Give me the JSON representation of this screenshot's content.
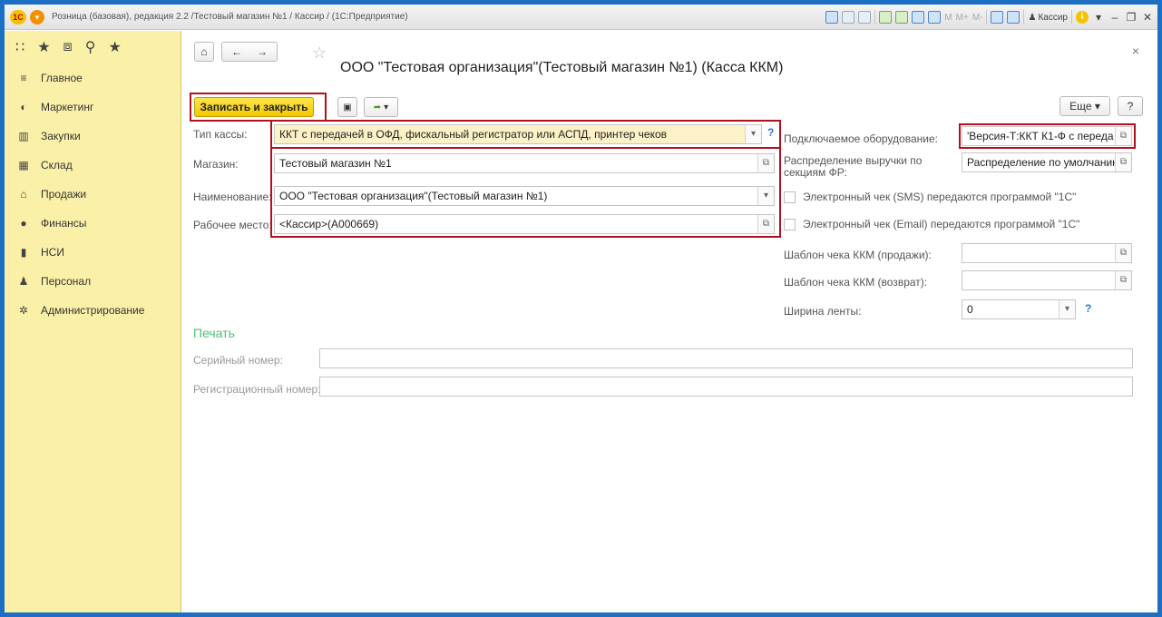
{
  "window": {
    "title": "Розница (базовая), редакция 2.2 /Тестовый магазин №1 / Кассир / (1С:Предприятие)",
    "logo_text": "1С",
    "user": "Кассир",
    "memory_buttons": [
      "M",
      "M+",
      "M-"
    ]
  },
  "sidebar": {
    "items": [
      {
        "label": "Главное",
        "icon": "menu-lines-icon"
      },
      {
        "label": "Маркетинг",
        "icon": "marketing-icon"
      },
      {
        "label": "Закупки",
        "icon": "cart-icon"
      },
      {
        "label": "Склад",
        "icon": "warehouse-icon"
      },
      {
        "label": "Продажи",
        "icon": "basket-icon"
      },
      {
        "label": "Финансы",
        "icon": "coin-icon"
      },
      {
        "label": "НСИ",
        "icon": "book-icon"
      },
      {
        "label": "Персонал",
        "icon": "person-icon"
      },
      {
        "label": "Администрирование",
        "icon": "gear-icon"
      }
    ]
  },
  "form": {
    "title": "ООО \"Тестовая организация\"(Тестовый магазин №1) (Касса ККМ)",
    "save_close_label": "Записать и закрыть",
    "more_label": "Еще",
    "help_label": "?",
    "fields": {
      "register_type_label": "Тип кассы:",
      "register_type_value": "ККТ с передачей в ОФД, фискальный регистратор или АСПД, принтер чеков",
      "store_label": "Магазин:",
      "store_value": "Тестовый магазин №1",
      "name_label": "Наименование:",
      "name_value": "ООО \"Тестовая организация\"(Тестовый магазин №1)",
      "workplace_label": "Рабочее место:",
      "workplace_value": "<Кассир>(А000669)",
      "equipment_label": "Подключаемое оборудование:",
      "equipment_value": "'Версия-Т:ККТ К1-Ф с переда",
      "distribution_label": "Распределение выручки по секциям ФР:",
      "distribution_value": "Распределение по умолчанию",
      "sms_check_label": "Электронный чек (SMS) передаются программой \"1С\"",
      "email_check_label": "Электронный чек (Email) передаются программой \"1С\"",
      "template_sale_label": "Шаблон чека ККМ (продажи):",
      "template_sale_value": "",
      "template_return_label": "Шаблон чека ККМ (возврат):",
      "template_return_value": "",
      "tape_width_label": "Ширина ленты:",
      "tape_width_value": "0"
    },
    "print_section": {
      "title": "Печать",
      "serial_label": "Серийный номер:",
      "serial_value": "",
      "reg_label": "Регистрационный номер:",
      "reg_value": ""
    }
  },
  "colors": {
    "accent_border": "#1d6fc4",
    "sidebar_bg": "#fbf0a8",
    "highlight_red": "#b0111e",
    "save_button": "#f4c800",
    "section_green": "#4ebf7a"
  }
}
